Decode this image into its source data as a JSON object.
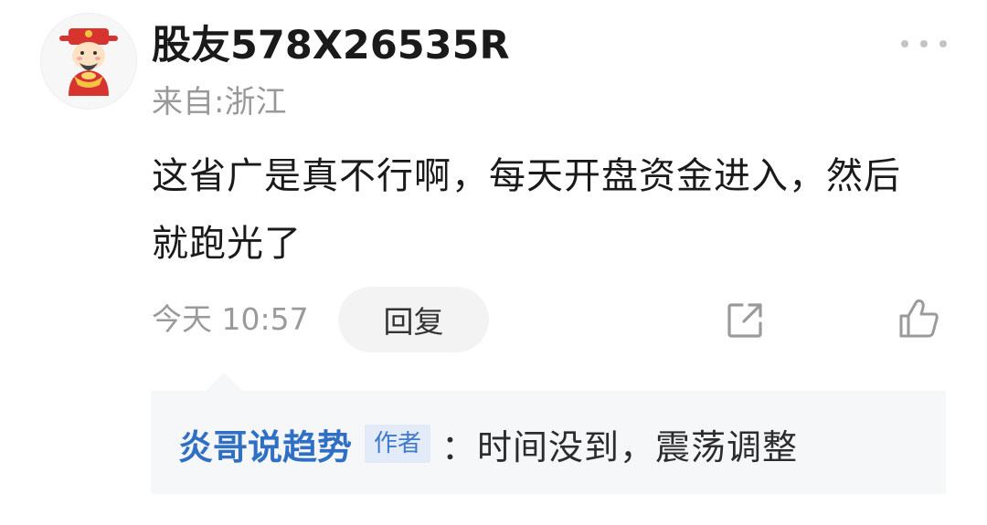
{
  "comment": {
    "username": "股友578X26535R",
    "location": "来自:浙江",
    "text": "这省广是真不行啊，每天开盘资金进入，然后就跑光了",
    "time": "今天 10:57",
    "reply_label": "回复",
    "icons": {
      "avatar": "caishen-avatar",
      "more": "more-dots-icon",
      "share": "share-icon",
      "like": "thumbs-up-icon"
    }
  },
  "reply": {
    "author": "炎哥说趋势",
    "badge": "作者",
    "text": "：时间没到，震荡调整"
  },
  "colors": {
    "author_link": "#2f6fc4",
    "badge_bg": "#e2ebf7",
    "reply_bg": "#f6f7f9",
    "muted_text": "#999999"
  }
}
